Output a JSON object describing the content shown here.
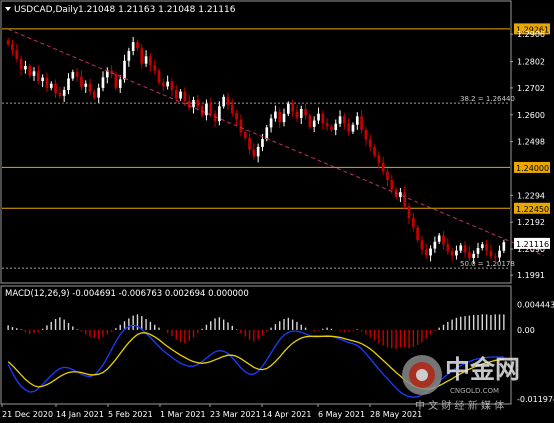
{
  "window": {
    "symbol_label": "USDCAD,Daily",
    "ohlc_label": "1.21048 1.21163 1.21048 1.21116"
  },
  "macd_label": "MACD(12,26,9) -0.004691 -0.006763 0.002694 0.000000",
  "watermark": {
    "title": "中金网",
    "domain": "CNGOLD.COM",
    "slogan": "中 文 财 经 新 媒 体"
  },
  "colors": {
    "background": "#000000",
    "up_candle": "#ffffff",
    "down_candle": "#c80000",
    "level_line": "#e8a800",
    "trend_line": "#c0306a",
    "fib_line": "#a0a0a0",
    "macd_line": "#1a3cff",
    "signal_line": "#e8d000",
    "hist_pos": "#d8d8d8",
    "hist_neg": "#c80000",
    "axis_text": "#ffffff",
    "price_tag_bg": "#ffffff"
  },
  "chart_data": [
    {
      "type": "candlestick",
      "series": "USDCAD Daily",
      "price_axis_ticks": [
        1.2906,
        1.2802,
        1.2702,
        1.26,
        1.2498,
        1.2294,
        1.2192,
        1.209,
        1.1991
      ],
      "ylim": [
        1.1965,
        1.2975
      ],
      "time_axis_labels": [
        "21 Dec 2020",
        "14 Jan 2021",
        "5 Feb 2021",
        "1 Mar 2021",
        "23 Mar 2021",
        "14 Apr 2021",
        "6 May 2021",
        "28 May 2021"
      ],
      "horizontal_levels": [
        {
          "value": 1.29261,
          "label": "1.29261"
        },
        {
          "value": 1.24,
          "label": "1.24000"
        },
        {
          "value": 1.2245,
          "label": "1.22450"
        }
      ],
      "fibonacci_levels": [
        {
          "value": 1.2644,
          "label": "38.2 = 1.26440"
        },
        {
          "value": 1.20178,
          "label": "50.0 = 1.20178"
        }
      ],
      "trendline": {
        "from": {
          "date": "21 Dec 2020",
          "value": 1.2925
        },
        "to": {
          "date": "11 Jun 2021",
          "value": 1.2065
        }
      },
      "current_price": {
        "value": 1.21116,
        "label": "1.21116"
      },
      "closes": [
        1.2868,
        1.2845,
        1.2812,
        1.2772,
        1.2785,
        1.2748,
        1.2765,
        1.2728,
        1.2741,
        1.2702,
        1.2718,
        1.2683,
        1.2672,
        1.2694,
        1.2738,
        1.2762,
        1.2745,
        1.2706,
        1.2718,
        1.2688,
        1.2665,
        1.2702,
        1.2742,
        1.2768,
        1.2755,
        1.2702,
        1.2734,
        1.2805,
        1.2842,
        1.2876,
        1.2852,
        1.2794,
        1.2822,
        1.2788,
        1.2768,
        1.2722,
        1.2708,
        1.2726,
        1.2694,
        1.2662,
        1.2688,
        1.2652,
        1.2628,
        1.2656,
        1.2632,
        1.2598,
        1.2642,
        1.2604,
        1.2576,
        1.2632,
        1.2668,
        1.2638,
        1.2606,
        1.2582,
        1.2534,
        1.2512,
        1.2468,
        1.2442,
        1.2478,
        1.2508,
        1.2552,
        1.2586,
        1.2612,
        1.2572,
        1.2604,
        1.2642,
        1.2612,
        1.2588,
        1.2622,
        1.2598,
        1.2554,
        1.2578,
        1.2604,
        1.2568,
        1.2556,
        1.2542,
        1.2566,
        1.2594,
        1.2568,
        1.2536,
        1.2562,
        1.2594,
        1.2542,
        1.2506,
        1.2478,
        1.2446,
        1.2418,
        1.2384,
        1.2352,
        1.2316,
        1.2288,
        1.2306,
        1.2252,
        1.2208,
        1.2172,
        1.2124,
        1.2088,
        1.2066,
        1.2092,
        1.2118,
        1.2142,
        1.2108,
        1.2082,
        1.2066,
        1.2084,
        1.2104,
        1.2078,
        1.2056,
        1.2072,
        1.2094,
        1.2108,
        1.2084,
        1.2062,
        1.2058,
        1.2084,
        1.2116
      ]
    },
    {
      "type": "macd",
      "params": "MACD(12,26,9)",
      "values": {
        "main": -0.004691,
        "signal": -0.006763,
        "histogram": 0.002694,
        "extra": 0.0
      },
      "axis_ticks": [
        0.004443,
        0.0,
        -0.011974
      ],
      "ylim": [
        -0.0127,
        0.0052
      ],
      "histogram": [
        0.0008,
        0.0005,
        0.0003,
        0.0001,
        -0.0004,
        -0.0007,
        -0.0006,
        -0.0004,
        0.0002,
        0.0008,
        0.0014,
        0.0019,
        0.0022,
        0.0018,
        0.0012,
        0.0006,
        0.0001,
        -0.0003,
        -0.0008,
        -0.0012,
        -0.0014,
        -0.0016,
        -0.0012,
        -0.0008,
        -0.0003,
        0.0003,
        0.0009,
        0.0015,
        0.002,
        0.0025,
        0.0027,
        0.0024,
        0.0019,
        0.0014,
        0.0009,
        0.0004,
        0.0,
        -0.0005,
        -0.0011,
        -0.0017,
        -0.0021,
        -0.0023,
        -0.0019,
        -0.0013,
        -0.0006,
        0.0002,
        0.0009,
        0.0015,
        0.002,
        0.0022,
        0.0018,
        0.0013,
        0.0007,
        0.0001,
        -0.0006,
        -0.0012,
        -0.0017,
        -0.002,
        -0.0016,
        -0.001,
        -0.0003,
        0.0004,
        0.001,
        0.0015,
        0.0019,
        0.0021,
        0.0018,
        0.0014,
        0.0009,
        0.0004,
        0.0,
        -0.0003,
        -0.0001,
        0.0002,
        0.0004,
        0.0002,
        0.0,
        -0.0002,
        -0.0004,
        -0.0003,
        -0.0001,
        0.0001,
        -0.0003,
        -0.0008,
        -0.0013,
        -0.0018,
        -0.0023,
        -0.0027,
        -0.003,
        -0.0032,
        -0.0033,
        -0.003,
        -0.0031,
        -0.0032,
        -0.003,
        -0.0026,
        -0.0021,
        -0.0015,
        -0.0008,
        -0.0002,
        0.0004,
        0.0009,
        0.0014,
        0.0018,
        0.0021,
        0.0023,
        0.0024,
        0.0025,
        0.0026,
        0.0026,
        0.0027,
        0.0027,
        0.0026,
        0.0027,
        0.0027,
        0.0027
      ],
      "main_line": [
        -0.006,
        -0.0075,
        -0.0088,
        -0.0098,
        -0.0104,
        -0.0108,
        -0.0107,
        -0.0102,
        -0.0095,
        -0.0087,
        -0.0079,
        -0.0072,
        -0.0067,
        -0.0065,
        -0.0066,
        -0.0069,
        -0.0073,
        -0.0077,
        -0.008,
        -0.0081,
        -0.0078,
        -0.0071,
        -0.0061,
        -0.0048,
        -0.0034,
        -0.002,
        -0.0008,
        0.0001,
        0.0006,
        0.0008,
        0.0006,
        0.0001,
        -0.0006,
        -0.0013,
        -0.0021,
        -0.0029,
        -0.0036,
        -0.0042,
        -0.0048,
        -0.0053,
        -0.0058,
        -0.0061,
        -0.0063,
        -0.0063,
        -0.006,
        -0.0055,
        -0.0049,
        -0.0043,
        -0.0038,
        -0.0036,
        -0.0037,
        -0.0041,
        -0.0048,
        -0.0057,
        -0.0066,
        -0.0073,
        -0.0077,
        -0.0077,
        -0.0072,
        -0.0063,
        -0.0052,
        -0.004,
        -0.0028,
        -0.0017,
        -0.0009,
        -0.0004,
        -0.0002,
        -0.0002,
        -0.0004,
        -0.0007,
        -0.001,
        -0.0012,
        -0.0012,
        -0.0011,
        -0.001,
        -0.0011,
        -0.0013,
        -0.0016,
        -0.0019,
        -0.0022,
        -0.0024,
        -0.0027,
        -0.0033,
        -0.0041,
        -0.005,
        -0.0059,
        -0.0068,
        -0.0077,
        -0.0085,
        -0.0093,
        -0.0101,
        -0.0108,
        -0.0113,
        -0.0116,
        -0.0117,
        -0.0116,
        -0.0113,
        -0.0108,
        -0.0102,
        -0.0096,
        -0.0089,
        -0.0083,
        -0.0077,
        -0.0071,
        -0.0066,
        -0.0062,
        -0.0058,
        -0.0055,
        -0.0052,
        -0.005,
        -0.0049,
        -0.0048,
        -0.0047,
        -0.0047,
        -0.0047,
        -0.0047
      ],
      "signal_line": [
        -0.0055,
        -0.0062,
        -0.007,
        -0.0078,
        -0.0086,
        -0.0092,
        -0.0097,
        -0.0099,
        -0.0098,
        -0.0095,
        -0.0091,
        -0.0086,
        -0.0081,
        -0.0077,
        -0.0074,
        -0.0073,
        -0.0073,
        -0.0074,
        -0.0076,
        -0.0078,
        -0.0078,
        -0.0077,
        -0.0074,
        -0.0068,
        -0.006,
        -0.0051,
        -0.0041,
        -0.0031,
        -0.0022,
        -0.0014,
        -0.0008,
        -0.0005,
        -0.0005,
        -0.0008,
        -0.0012,
        -0.0017,
        -0.0023,
        -0.0029,
        -0.0034,
        -0.0039,
        -0.0044,
        -0.0048,
        -0.0052,
        -0.0055,
        -0.0057,
        -0.0058,
        -0.0057,
        -0.0055,
        -0.0052,
        -0.0049,
        -0.0046,
        -0.0044,
        -0.0044,
        -0.0046,
        -0.005,
        -0.0055,
        -0.006,
        -0.0065,
        -0.0068,
        -0.0069,
        -0.0067,
        -0.0062,
        -0.0055,
        -0.0047,
        -0.0038,
        -0.003,
        -0.0023,
        -0.0018,
        -0.0014,
        -0.0012,
        -0.0011,
        -0.0011,
        -0.0011,
        -0.0011,
        -0.0011,
        -0.0011,
        -0.0012,
        -0.0013,
        -0.0015,
        -0.0017,
        -0.0019,
        -0.0021,
        -0.0024,
        -0.0028,
        -0.0033,
        -0.0039,
        -0.0046,
        -0.0053,
        -0.006,
        -0.0067,
        -0.0074,
        -0.008,
        -0.0087,
        -0.0092,
        -0.0097,
        -0.01,
        -0.0102,
        -0.0103,
        -0.0102,
        -0.01,
        -0.0097,
        -0.0093,
        -0.0089,
        -0.0085,
        -0.008,
        -0.0076,
        -0.0072,
        -0.0068,
        -0.0065,
        -0.0062,
        -0.0059,
        -0.0057,
        -0.0055,
        -0.0053,
        -0.0052,
        -0.0051
      ]
    }
  ]
}
